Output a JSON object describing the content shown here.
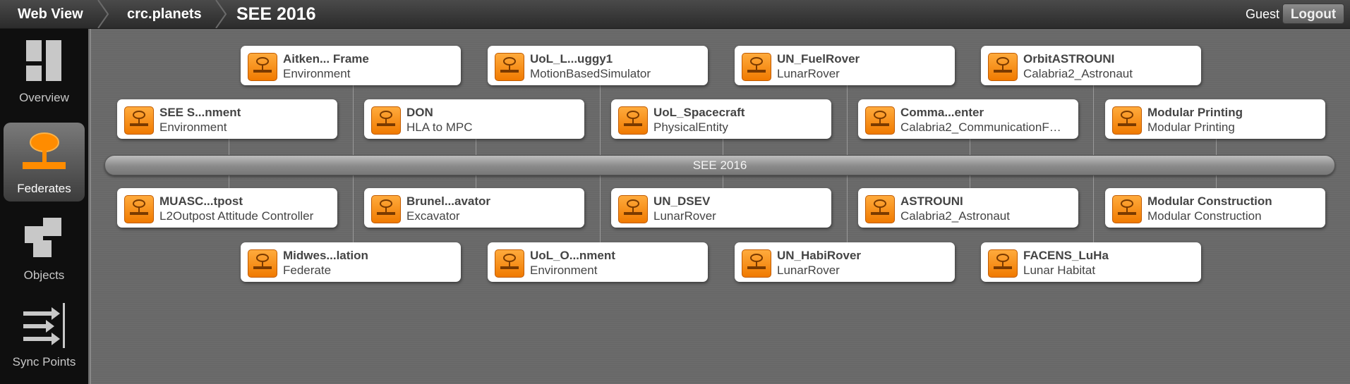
{
  "header": {
    "breadcrumbs": [
      "Web View",
      "crc.planets",
      "SEE 2016"
    ],
    "user": "Guest",
    "logout_label": "Logout"
  },
  "sidebar": {
    "items": [
      {
        "label": "Overview",
        "icon": "overview-icon",
        "active": false
      },
      {
        "label": "Federates",
        "icon": "federate-icon",
        "active": true
      },
      {
        "label": "Objects",
        "icon": "objects-icon",
        "active": false
      },
      {
        "label": "Sync Points",
        "icon": "sync-points-icon",
        "active": false
      }
    ]
  },
  "bus": {
    "label": "SEE 2016"
  },
  "colors": {
    "accent": "#f58a0b",
    "card": "#ffffff",
    "background": "#686868"
  },
  "federates": [
    {
      "name": "Aitken... Frame",
      "type": "Environment"
    },
    {
      "name": "UoL_L...uggy1",
      "type": "MotionBasedSimulator"
    },
    {
      "name": "UN_FuelRover",
      "type": "LunarRover"
    },
    {
      "name": "OrbitASTROUNI",
      "type": "Calabria2_Astronaut"
    },
    {
      "name": "SEE S...nment",
      "type": "Environment"
    },
    {
      "name": "DON",
      "type": "HLA to MPC"
    },
    {
      "name": "UoL_Spacecraft",
      "type": "PhysicalEntity"
    },
    {
      "name": "Comma...enter",
      "type": "Calabria2_CommunicationF…"
    },
    {
      "name": "Modular Printing",
      "type": "Modular Printing"
    },
    {
      "name": "MUASC...tpost",
      "type": "L2Outpost Attitude Controller"
    },
    {
      "name": "Brunel...avator",
      "type": "Excavator"
    },
    {
      "name": "UN_DSEV",
      "type": "LunarRover"
    },
    {
      "name": "ASTROUNI",
      "type": "Calabria2_Astronaut"
    },
    {
      "name": "Modular Construction",
      "type": "Modular Construction"
    },
    {
      "name": "Midwes...lation",
      "type": "Federate"
    },
    {
      "name": "UoL_O...nment",
      "type": "Environment"
    },
    {
      "name": "UN_HabiRover",
      "type": "LunarRover"
    },
    {
      "name": "FACENS_LuHa",
      "type": "Lunar Habitat"
    }
  ]
}
